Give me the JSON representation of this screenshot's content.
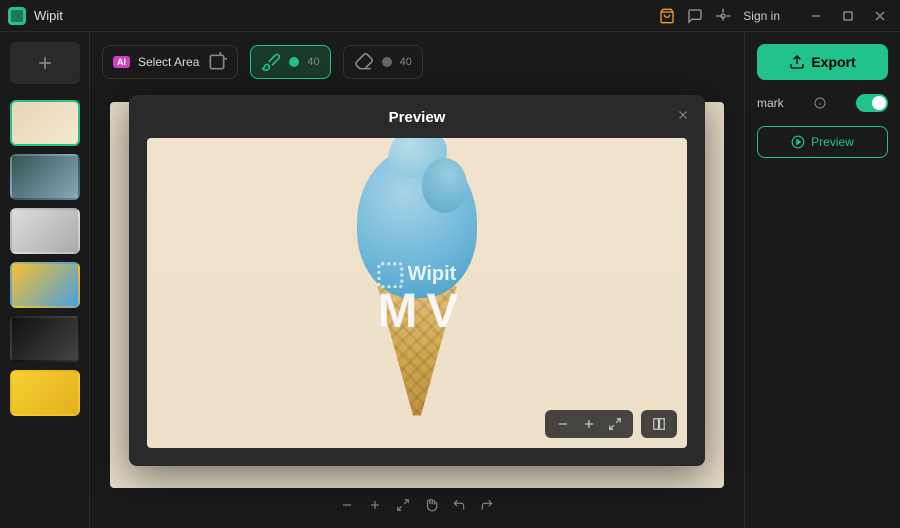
{
  "app": {
    "title": "Wipit"
  },
  "titlebar": {
    "signin": "Sign in"
  },
  "toolbar": {
    "select_area": "Select Area",
    "brush_size": "40",
    "eraser_size": "40"
  },
  "rightpanel": {
    "export": "Export",
    "watermark_label": "mark",
    "watermark_on": true,
    "preview": "Preview"
  },
  "modal": {
    "title": "Preview",
    "watermark_brand": "Wipit",
    "watermark_sub": "M   V"
  },
  "thumbnails": [
    {
      "desc": "ice-cream-cone-cream-bg",
      "active": true
    },
    {
      "desc": "living-room-sofa",
      "active": false
    },
    {
      "desc": "person-outdoors-light",
      "active": false
    },
    {
      "desc": "yellow-flowers-sky",
      "active": false
    },
    {
      "desc": "astronaut-space",
      "active": false
    },
    {
      "desc": "woman-yellow-flowers",
      "active": false
    }
  ]
}
